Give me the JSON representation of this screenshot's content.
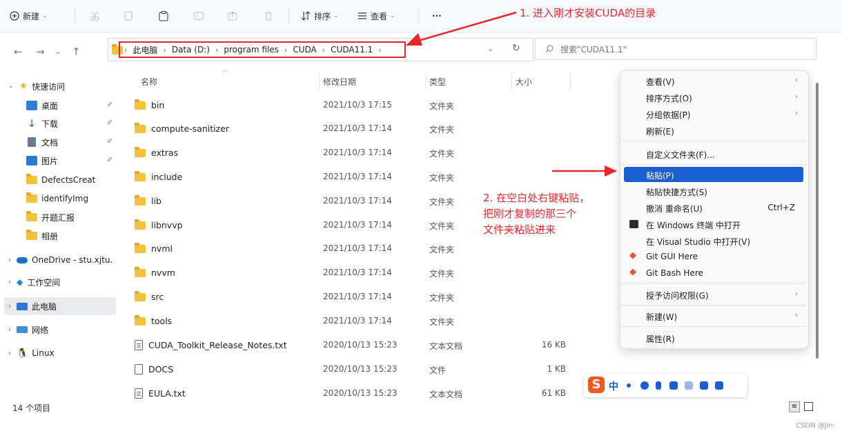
{
  "toolbar": {
    "new_label": "新建",
    "sort_label": "排序",
    "view_label": "查看",
    "more_label": "···"
  },
  "address": {
    "segments": [
      "此电脑",
      "Data (D:)",
      "program files",
      "CUDA",
      "CUDA11.1"
    ],
    "search_placeholder": "搜索\"CUDA11.1\""
  },
  "sidebar": {
    "quick_access": "快速访问",
    "items": [
      {
        "label": "桌面",
        "pinned": true
      },
      {
        "label": "下载",
        "pinned": true
      },
      {
        "label": "文档",
        "pinned": true
      },
      {
        "label": "图片",
        "pinned": true
      },
      {
        "label": "DefectsCreat"
      },
      {
        "label": "identifyImg"
      },
      {
        "label": "开题汇报"
      },
      {
        "label": "相册"
      }
    ],
    "onedrive": "OneDrive - stu.xjtu.",
    "workspace": "工作空间",
    "this_pc": "此电脑",
    "network": "网络",
    "linux": "Linux"
  },
  "columns": {
    "name": "名称",
    "date": "修改日期",
    "type": "类型",
    "size": "大小"
  },
  "files": [
    {
      "name": "bin",
      "date": "2021/10/3 17:15",
      "type": "文件夹",
      "size": "",
      "kind": "folder"
    },
    {
      "name": "compute-sanitizer",
      "date": "2021/10/3 17:14",
      "type": "文件夹",
      "size": "",
      "kind": "folder"
    },
    {
      "name": "extras",
      "date": "2021/10/3 17:14",
      "type": "文件夹",
      "size": "",
      "kind": "folder"
    },
    {
      "name": "include",
      "date": "2021/10/3 17:14",
      "type": "文件夹",
      "size": "",
      "kind": "folder"
    },
    {
      "name": "lib",
      "date": "2021/10/3 17:14",
      "type": "文件夹",
      "size": "",
      "kind": "folder"
    },
    {
      "name": "libnvvp",
      "date": "2021/10/3 17:14",
      "type": "文件夹",
      "size": "",
      "kind": "folder"
    },
    {
      "name": "nvml",
      "date": "2021/10/3 17:14",
      "type": "文件夹",
      "size": "",
      "kind": "folder"
    },
    {
      "name": "nvvm",
      "date": "2021/10/3 17:14",
      "type": "文件夹",
      "size": "",
      "kind": "folder"
    },
    {
      "name": "src",
      "date": "2021/10/3 17:14",
      "type": "文件夹",
      "size": "",
      "kind": "folder"
    },
    {
      "name": "tools",
      "date": "2021/10/3 17:14",
      "type": "文件夹",
      "size": "",
      "kind": "folder"
    },
    {
      "name": "CUDA_Toolkit_Release_Notes.txt",
      "date": "2020/10/13 15:23",
      "type": "文本文档",
      "size": "16 KB",
      "kind": "text"
    },
    {
      "name": "DOCS",
      "date": "2020/10/13 15:23",
      "type": "文件",
      "size": "1 KB",
      "kind": "file"
    },
    {
      "name": "EULA.txt",
      "date": "2020/10/13 15:23",
      "type": "文本文档",
      "size": "61 KB",
      "kind": "text"
    }
  ],
  "context_menu": {
    "view": "查看(V)",
    "sort_by": "排序方式(O)",
    "group_by": "分组依据(P)",
    "refresh": "刷新(E)",
    "customize": "自定义文件夹(F)...",
    "paste": "粘贴(P)",
    "paste_shortcut": "粘贴快捷方式(S)",
    "undo_rename": "撤消 重命名(U)",
    "undo_shortcut": "Ctrl+Z",
    "open_terminal": "在 Windows 终端 中打开",
    "open_vs": "在 Visual Studio 中打开(V)",
    "git_gui": "Git GUI Here",
    "git_bash": "Git Bash Here",
    "grant_access": "授予访问权限(G)",
    "new": "新建(W)",
    "properties": "属性(R)"
  },
  "annotations": {
    "step1": "1. 进入刚才安装CUDA的目录",
    "step2_line1": "2. 在空白处右键粘贴，",
    "step2_line2": "把刚才复制的那三个",
    "step2_line3": "文件夹粘贴进来"
  },
  "status": {
    "item_count": "14 个项目"
  },
  "ime": {
    "mode": "中"
  },
  "watermark": "CSDN @Jin·",
  "colors": {
    "annotation_red": "#e8262b",
    "highlight_blue": "#1a5fd1",
    "folder_yellow": "#f4c23a"
  }
}
